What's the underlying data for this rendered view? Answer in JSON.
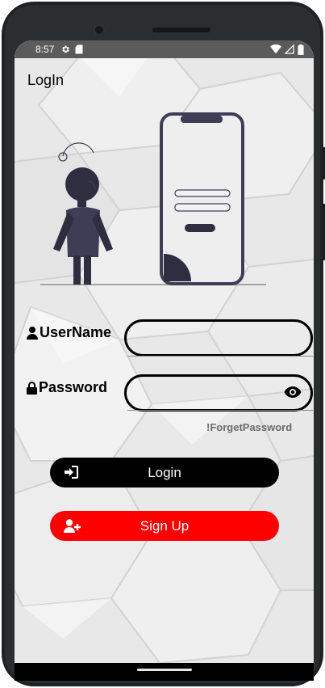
{
  "status_bar": {
    "time": "8:57",
    "icons_left": [
      "gear-icon",
      "sd-card-icon"
    ],
    "icons_right": [
      "wifi-icon",
      "signal-icon",
      "battery-icon"
    ]
  },
  "title": "LogIn",
  "username": {
    "label": "UserName",
    "icon": "user-icon",
    "value": ""
  },
  "password": {
    "label": "Password",
    "icon": "lock-icon",
    "value": "",
    "toggle_icon": "eye-icon"
  },
  "forget_password": "!ForgetPassword",
  "buttons": {
    "login": {
      "label": "Login",
      "icon": "sign-in-icon",
      "color": "#000000"
    },
    "signup": {
      "label": "Sign Up",
      "icon": "user-plus-icon",
      "color": "#ff0000"
    }
  },
  "colors": {
    "accent_dark": "#3f3d56",
    "background": "#e6e6e6"
  }
}
